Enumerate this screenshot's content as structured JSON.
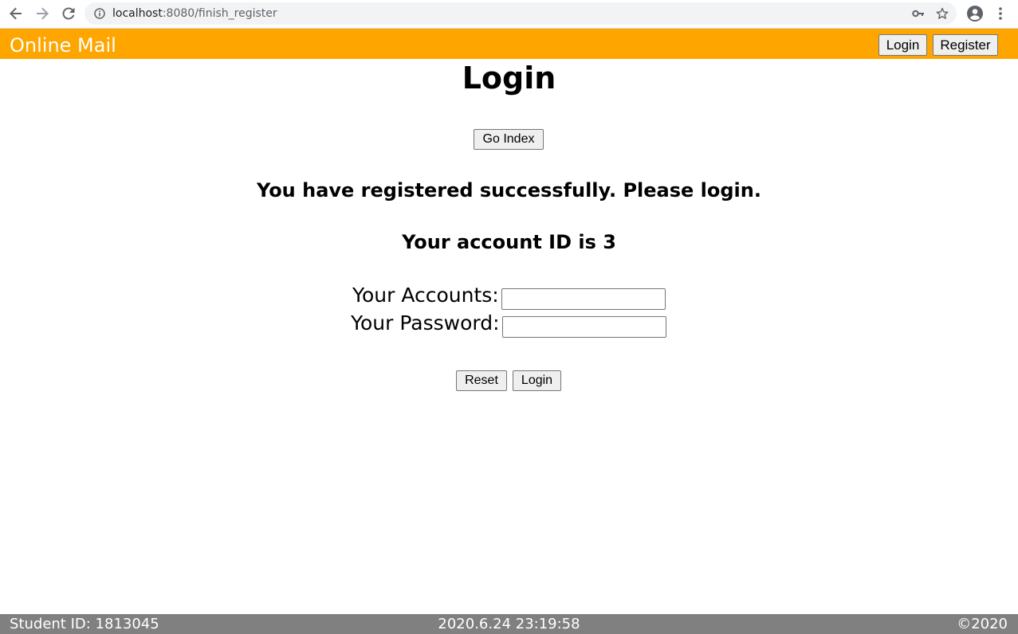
{
  "browser": {
    "url_host": "localhost",
    "url_path": ":8080/finish_register",
    "icons": [
      "back-icon",
      "forward-icon",
      "reload-icon",
      "info-icon",
      "key-icon",
      "star-icon",
      "profile-icon",
      "menu-icon"
    ]
  },
  "header": {
    "brand": "Online Mail",
    "login_label": "Login",
    "register_label": "Register",
    "background": "#ffa500"
  },
  "main": {
    "title": "Login",
    "go_index_label": "Go Index",
    "success_message": "You have registered successfully. Please login.",
    "account_message": "Your account ID is 3",
    "accounts_label": "Your Accounts:",
    "accounts_value": "",
    "password_label": "Your Password:",
    "password_value": "",
    "reset_label": "Reset",
    "login_label": "Login"
  },
  "footer": {
    "student_id": "Student ID: 1813045",
    "timestamp": "2020.6.24 23:19:58",
    "copyright": "©2020",
    "background": "#808080"
  }
}
